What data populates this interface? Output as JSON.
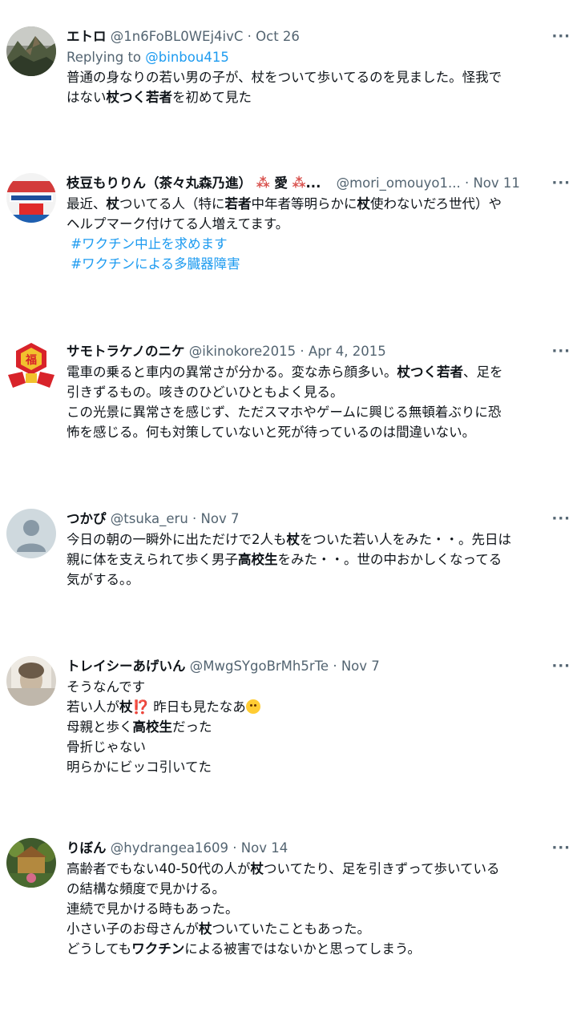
{
  "more_label": "···",
  "tweets": [
    {
      "name": "エトロ",
      "handle": "@1n6FoBL0WEj4ivC",
      "sep": "·",
      "date": "Oct 26",
      "replying_prefix": "Replying to",
      "replying_handle": "@binbou415",
      "lines": [
        [
          "普通の身なりの若い男の子が、杖をついて歩いてるのを見ました。怪我で"
        ],
        [
          "はない",
          "杖つく若者",
          "を初めて見た"
        ]
      ]
    },
    {
      "name": "枝豆もりりん（茶々丸森乃進）",
      "name_suffix": "愛",
      "name_ellipsis": "...",
      "handle": "@mori_omouyo1...",
      "sep": "·",
      "date": "Nov 11",
      "lines": [
        [
          "最近、",
          "杖",
          "ついてる人（特に",
          "若者",
          "中年者等明らかに",
          "杖",
          "使わないだろ世代）や"
        ],
        [
          "ヘルプマーク付けてる人増えてます。"
        ]
      ],
      "hashtags": [
        "#ワクチン中止を求めます",
        "#ワクチンによる多臓器障害"
      ]
    },
    {
      "name": "サモトラケノのニケ",
      "handle": "@ikinokore2015",
      "sep": "·",
      "date": "Apr 4, 2015",
      "avatar_char": "福",
      "lines": [
        [
          "電車の乗ると車内の異常さが分かる。変な赤ら顔多い。",
          "杖つく若者",
          "、足を"
        ],
        [
          "引きずるもの。咳きのひどいひともよく見る。"
        ],
        [
          "この光景に異常さを感じず、ただスマホやゲームに興じる無頓着ぶりに恐"
        ],
        [
          "怖を感じる。何も対策していないと死が待っているのは間違いない。"
        ]
      ]
    },
    {
      "name": "つかぴ",
      "handle": "@tsuka_eru",
      "sep": "·",
      "date": "Nov 7",
      "lines": [
        [
          "今日の朝の一瞬外に出ただけで2人も",
          "杖",
          "をついた若い人をみた・・。先日は"
        ],
        [
          "親に体を支えられて歩く男子",
          "高校生",
          "をみた・・。世の中おかしくなってる"
        ],
        [
          "気がする。。"
        ]
      ]
    },
    {
      "name": "トレイシーあげいん",
      "handle": "@MwgSYgoBrMh5rTe",
      "sep": "·",
      "date": "Nov 7",
      "lines": [
        [
          "そうなんです"
        ],
        [
          "若い人が",
          "杖",
          "⁉️",
          " 昨日も見たなあ"
        ],
        [
          "母親と歩く",
          "高校生",
          "だった"
        ],
        [
          "骨折じゃない"
        ],
        [
          "明らかにビッコ引いてた"
        ]
      ]
    },
    {
      "name": "りぼん",
      "handle": "@hydrangea1609",
      "sep": "·",
      "date": "Nov 14",
      "lines": [
        [
          "高齢者でもない40-50代の人が",
          "杖",
          "ついてたり、足を引きずって歩いている"
        ],
        [
          "の結構な頻度で見かける。"
        ],
        [
          "連続で見かける時もあった。"
        ],
        [
          "小さい子のお母さんが",
          "杖",
          "ついていたこともあった。"
        ],
        [
          "どうしても",
          "ワクチン",
          "による被害ではないかと思ってしまう。"
        ]
      ]
    }
  ]
}
